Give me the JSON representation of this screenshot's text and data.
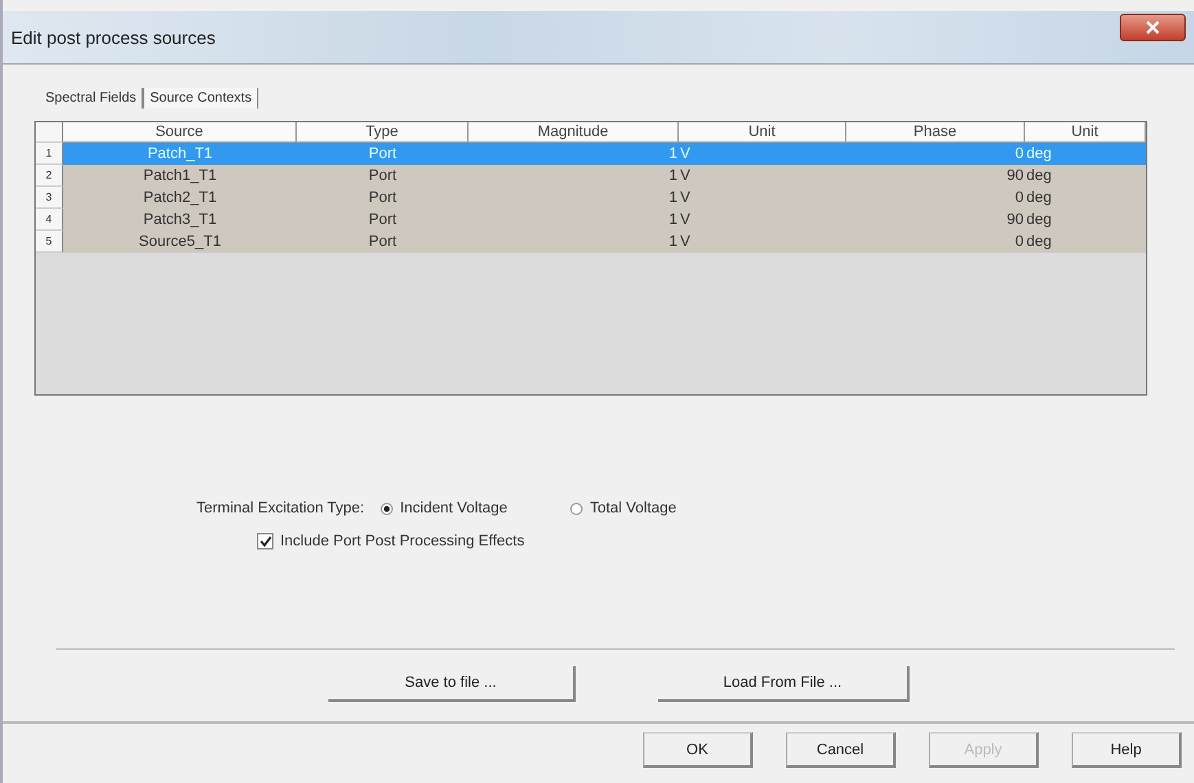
{
  "window": {
    "title": "Edit post process sources"
  },
  "tabs": [
    {
      "label": "Spectral Fields",
      "selected": true
    },
    {
      "label": "Source Contexts",
      "selected": false
    }
  ],
  "table": {
    "columns": [
      "Source",
      "Type",
      "Magnitude",
      "Unit",
      "Phase",
      "Unit"
    ],
    "rows": [
      {
        "index": "1",
        "source": "Patch_T1",
        "type": "Port",
        "magnitude": "1",
        "magnitude_unit": "V",
        "phase": "0",
        "phase_unit": "deg",
        "selected": true
      },
      {
        "index": "2",
        "source": "Patch1_T1",
        "type": "Port",
        "magnitude": "1",
        "magnitude_unit": "V",
        "phase": "90",
        "phase_unit": "deg",
        "selected": false
      },
      {
        "index": "3",
        "source": "Patch2_T1",
        "type": "Port",
        "magnitude": "1",
        "magnitude_unit": "V",
        "phase": "0",
        "phase_unit": "deg",
        "selected": false
      },
      {
        "index": "4",
        "source": "Patch3_T1",
        "type": "Port",
        "magnitude": "1",
        "magnitude_unit": "V",
        "phase": "90",
        "phase_unit": "deg",
        "selected": false
      },
      {
        "index": "5",
        "source": "Source5_T1",
        "type": "Port",
        "magnitude": "1",
        "magnitude_unit": "V",
        "phase": "0",
        "phase_unit": "deg",
        "selected": false
      }
    ]
  },
  "excitation": {
    "label": "Terminal Excitation Type:",
    "options": [
      {
        "label": "Incident Voltage",
        "selected": true
      },
      {
        "label": "Total Voltage",
        "selected": false
      }
    ]
  },
  "include_effects": {
    "label": "Include Port Post Processing Effects",
    "checked": true
  },
  "file_buttons": [
    "Save to file ...",
    "Load From File ..."
  ],
  "dialog_buttons": [
    {
      "label": "OK",
      "disabled": false
    },
    {
      "label": "Cancel",
      "disabled": false
    },
    {
      "label": "Apply",
      "disabled": true
    },
    {
      "label": "Help",
      "disabled": false
    }
  ]
}
